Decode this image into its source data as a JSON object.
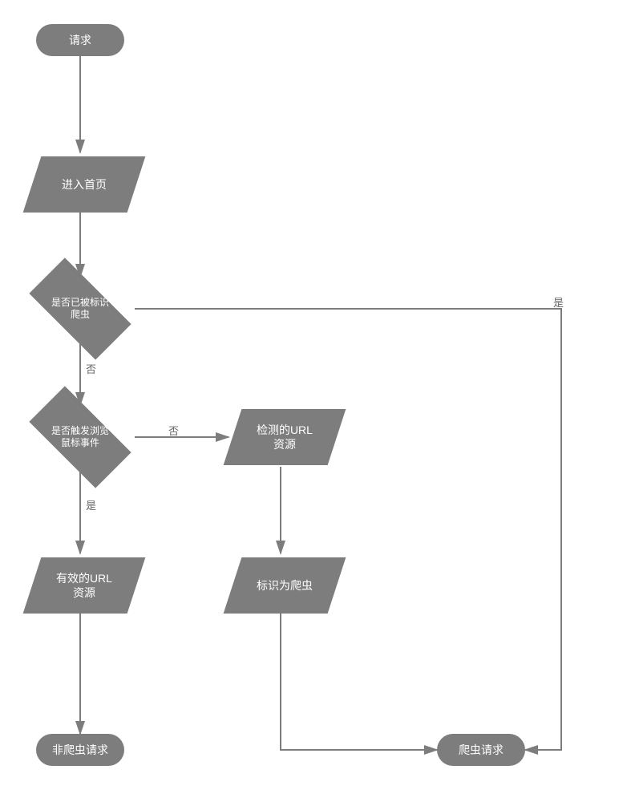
{
  "diagram": {
    "start": "请求",
    "enter_homepage": "进入首页",
    "decision_marked_crawler": "是否已被标识\n爬虫",
    "decision_mouse_event": "是否触发浏览\n鼠标事件",
    "check_url_resource": "检测的URL\n资源",
    "valid_url_resource": "有效的URL\n资源",
    "mark_as_crawler": "标识为爬虫",
    "end_not_crawler": "非爬虫请求",
    "end_crawler": "爬虫请求",
    "labels": {
      "yes": "是",
      "no": "否"
    }
  }
}
